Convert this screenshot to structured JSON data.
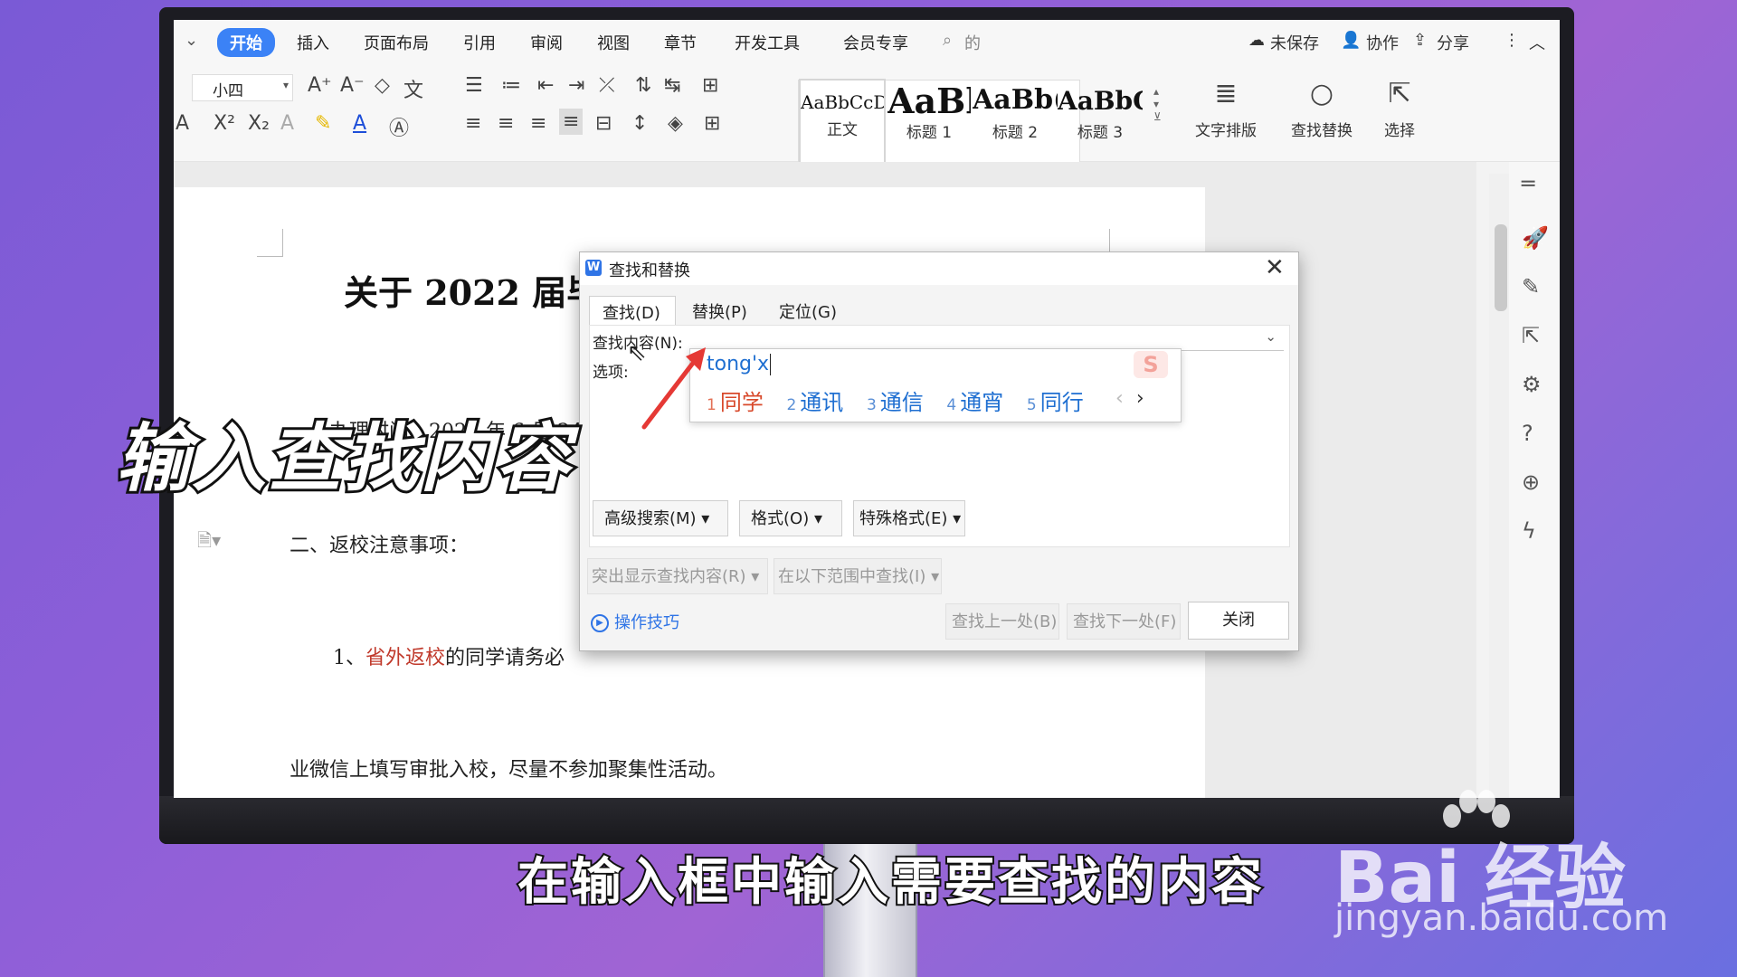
{
  "menu": {
    "items": [
      "开始",
      "插入",
      "页面布局",
      "引用",
      "审阅",
      "视图",
      "章节",
      "开发工具",
      "会员专享"
    ],
    "search_hint": "的",
    "unsaved": "未保存",
    "collab": "协作",
    "share": "分享"
  },
  "ribbon": {
    "font_size": "小四",
    "styles": [
      {
        "sample": "AaBbCcDd",
        "caption": "正文"
      },
      {
        "sample": "AaBl",
        "caption": "标题 1"
      },
      {
        "sample": "AaBb(",
        "caption": "标题 2"
      },
      {
        "sample": "AaBbC",
        "caption": "标题 3"
      }
    ],
    "text_layout": "文字排版",
    "find_replace": "查找替换",
    "select": "选择"
  },
  "document": {
    "title": "关于 2022 届毕",
    "line1": "一、办理时间：2022 年 6 月 24",
    "line2": "二、返校注意事项：",
    "line3_prefix": "1、",
    "line3_red": "省外返校",
    "line3_rest": "的同学请务必",
    "line4": "业微信上填写审批入校，尽量不参加聚集性活动。"
  },
  "dialog": {
    "title": "查找和替换",
    "tabs": [
      "查找(D)",
      "替换(P)",
      "定位(G)"
    ],
    "find_label": "查找内容(N):",
    "options_label": "选项:",
    "advanced_search": "高级搜索(M)",
    "format": "格式(O)",
    "special_format": "特殊格式(E)",
    "highlight": "突出显示查找内容(R)",
    "find_in": "在以下范围中查找(I)",
    "tips": "操作技巧",
    "find_prev": "查找上一处(B)",
    "find_next": "查找下一处(F)",
    "close": "关闭"
  },
  "ime": {
    "composition": "tong'x",
    "candidates": [
      {
        "n": "1",
        "text": "同学"
      },
      {
        "n": "2",
        "text": "通讯"
      },
      {
        "n": "3",
        "text": "通信"
      },
      {
        "n": "4",
        "text": "通宵"
      },
      {
        "n": "5",
        "text": "同行"
      }
    ]
  },
  "overlay": {
    "title": "输入查找内容",
    "subtitle": "在输入框中输入需要查找的内容"
  },
  "watermark": {
    "brand": "Bai  经验",
    "url": "jingyan.baidu.com"
  },
  "colors": {
    "accent": "#3b82f6",
    "arrow": "#e53935",
    "link": "#2f74e6"
  }
}
